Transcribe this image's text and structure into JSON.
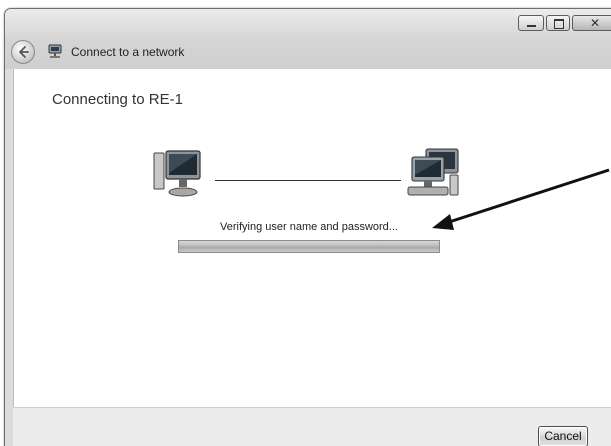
{
  "window": {
    "title": "Connect to a network",
    "controls": {
      "minimize_icon": "minimize-icon",
      "maximize_icon": "maximize-icon",
      "close_glyph": "✕"
    }
  },
  "main": {
    "heading": "Connecting to RE-1",
    "status": "Verifying user name and password...",
    "progress_fraction": 1.0
  },
  "footer": {
    "cancel_label": "Cancel"
  },
  "icons": {
    "back": "back-arrow-icon",
    "network": "network-icon",
    "this_computer": "computer-icon",
    "remote_computer": "network-computers-icon"
  }
}
